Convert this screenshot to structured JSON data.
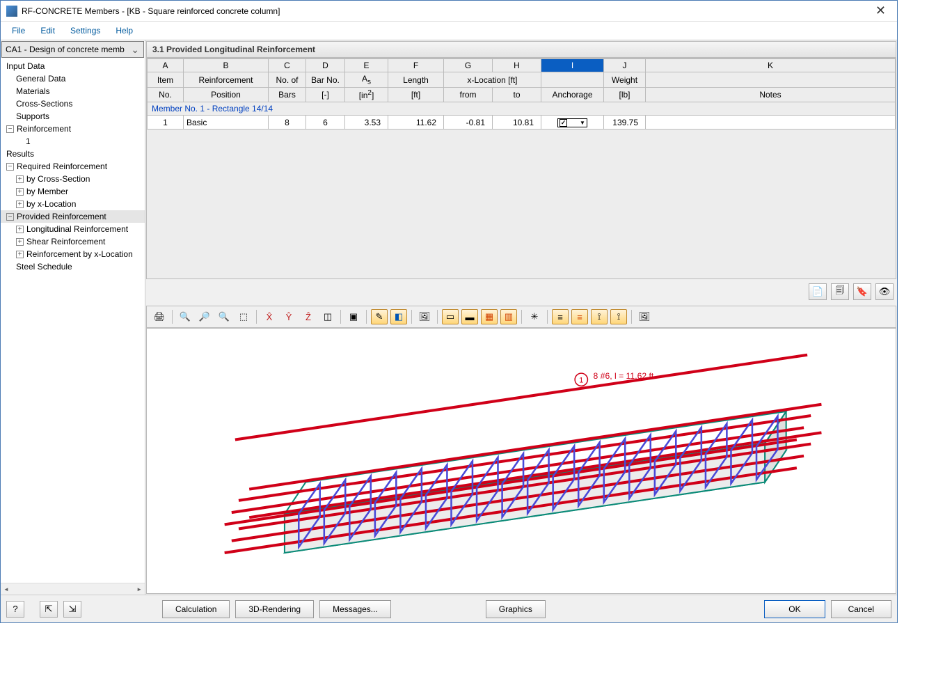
{
  "window": {
    "title": "RF-CONCRETE Members - [KB - Square reinforced concrete column]"
  },
  "menu": {
    "file": "File",
    "edit": "Edit",
    "settings": "Settings",
    "help": "Help"
  },
  "sidebar": {
    "combo": "CA1 - Design of concrete memb",
    "root_input": "Input Data",
    "items_input": [
      "General Data",
      "Materials",
      "Cross-Sections",
      "Supports"
    ],
    "reinforcement": "Reinforcement",
    "reinforcement_child": "1",
    "root_results": "Results",
    "required": "Required Reinforcement",
    "required_items": [
      "by Cross-Section",
      "by Member",
      "by x-Location"
    ],
    "provided": "Provided Reinforcement",
    "provided_items": [
      "Longitudinal Reinforcement",
      "Shear Reinforcement",
      "Reinforcement by x-Location",
      "Steel Schedule"
    ]
  },
  "section": {
    "title": "3.1 Provided Longitudinal Reinforcement"
  },
  "table": {
    "letters": [
      "A",
      "B",
      "C",
      "D",
      "E",
      "F",
      "G",
      "H",
      "I",
      "J",
      "K"
    ],
    "h1": {
      "item": "Item",
      "rpos": "Reinforcement",
      "nbars": "No. of",
      "barno": "Bar No.",
      "as": "A",
      "len": "Length",
      "xloc": "x-Location [ft]",
      "anch": "",
      "wt": "Weight",
      "notes": ""
    },
    "h2": {
      "item": "No.",
      "rpos": "Position",
      "nbars": "Bars",
      "barno": "[-]",
      "as": "[in",
      "len": "[ft]",
      "from": "from",
      "to": "to",
      "anch": "Anchorage",
      "wt": "[lb]",
      "notes": "Notes"
    },
    "as_sub": "s",
    "as_unit_exp": "2",
    "as_unit_close": "]",
    "member_row": "Member No. 1  -  Rectangle 14/14",
    "row": {
      "item": "1",
      "pos": "Basic",
      "nbars": "8",
      "barno": "6",
      "as": "3.53",
      "len": "11.62",
      "from": "-0.81",
      "to": "10.81",
      "wt": "139.75"
    }
  },
  "viewport": {
    "label": "8 #6, l = 11.62 ft",
    "circ": "1"
  },
  "footer": {
    "calc": "Calculation",
    "render": "3D-Rendering",
    "msg": "Messages...",
    "gfx": "Graphics",
    "ok": "OK",
    "cancel": "Cancel"
  }
}
